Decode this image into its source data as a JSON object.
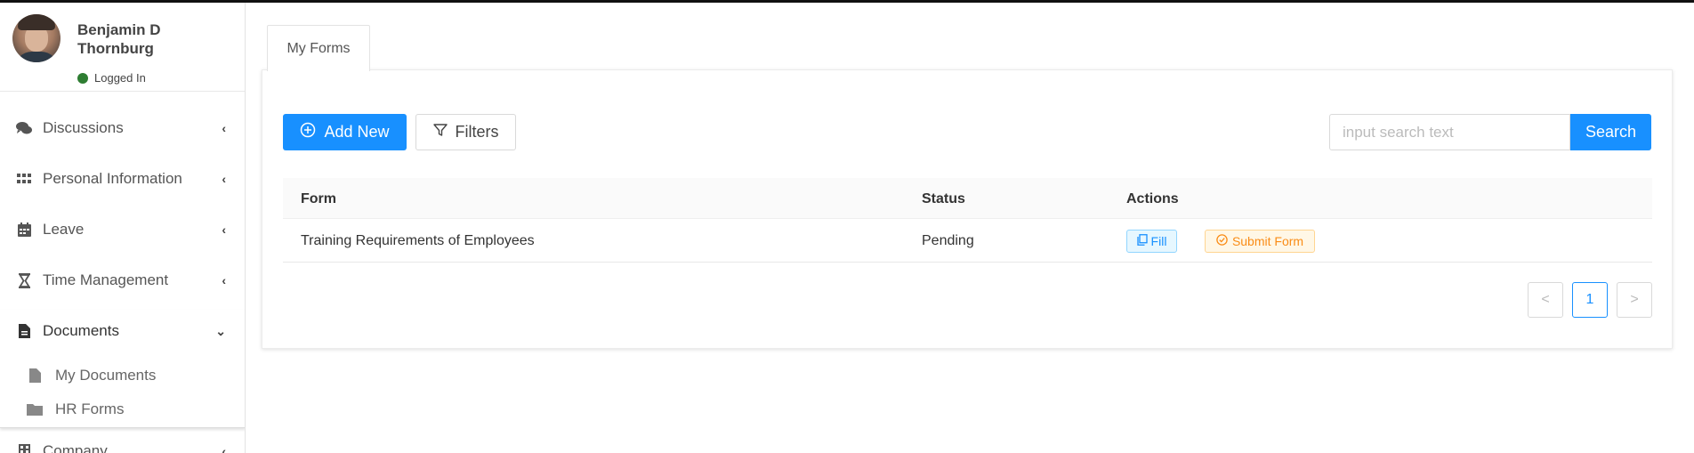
{
  "user": {
    "name": "Benjamin D Thornburg",
    "status": "Logged In",
    "status_color": "#2e7d32"
  },
  "sidebar": {
    "items": [
      {
        "label": "Discussions",
        "icon": "comments-icon",
        "chevron": "‹"
      },
      {
        "label": "Personal Information",
        "icon": "grid-icon",
        "chevron": "‹"
      },
      {
        "label": "Leave",
        "icon": "calendar-icon",
        "chevron": "‹"
      },
      {
        "label": "Time Management",
        "icon": "hourglass-icon",
        "chevron": "‹"
      },
      {
        "label": "Documents",
        "icon": "document-icon",
        "chevron": "⌄"
      },
      {
        "label": "Company",
        "icon": "building-icon",
        "chevron": "‹"
      }
    ],
    "sub_items": [
      {
        "label": "My Documents",
        "icon": "file-icon"
      },
      {
        "label": "HR Forms",
        "icon": "folder-icon"
      }
    ]
  },
  "main": {
    "tab_label": "My Forms",
    "add_new_label": "Add New",
    "filters_label": "Filters",
    "search": {
      "placeholder": "input search text",
      "value": "",
      "button_label": "Search"
    },
    "table": {
      "columns": [
        "Form",
        "Status",
        "Actions"
      ],
      "rows": [
        {
          "form": "Training Requirements of Employees",
          "status": "Pending",
          "actions": [
            "Fill",
            "Submit Form"
          ]
        }
      ]
    },
    "pagination": {
      "prev": "<",
      "current": "1",
      "next": ">"
    }
  },
  "colors": {
    "primary": "#1890ff",
    "tag_blue": "#1890ff",
    "tag_orange": "#fa8c16"
  }
}
